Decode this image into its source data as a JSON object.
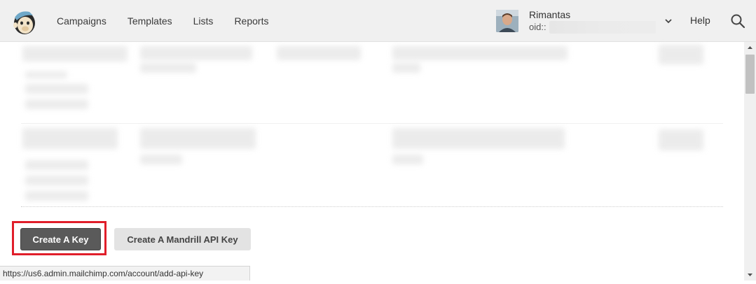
{
  "nav": {
    "items": [
      {
        "label": "Campaigns"
      },
      {
        "label": "Templates"
      },
      {
        "label": "Lists"
      },
      {
        "label": "Reports"
      }
    ],
    "help_label": "Help"
  },
  "account": {
    "name": "Rimantas",
    "id_prefix": "oid::"
  },
  "actions": {
    "create_key_label": "Create A Key",
    "mandrill_label": "Create A Mandrill API Key"
  },
  "status": {
    "url": "https://us6.admin.mailchimp.com/account/add-api-key"
  },
  "colors": {
    "highlight": "#e01e2a",
    "primary_button": "#5a5a5a",
    "secondary_button": "#e3e3e3"
  }
}
